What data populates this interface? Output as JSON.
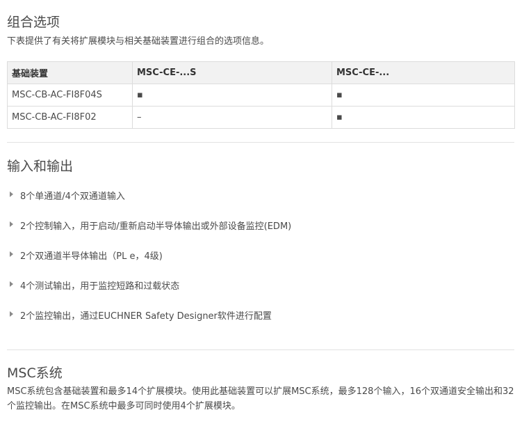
{
  "combo": {
    "title": "组合选项",
    "intro": "下表提供了有关将扩展模块与相关基础装置进行组合的选项信息。",
    "table": {
      "headers": [
        "基础装置",
        "MSC-CE-...S",
        "MSC-CE-..."
      ],
      "rows": [
        [
          "MSC-CB-AC-FI8F04S",
          "▪",
          "▪"
        ],
        [
          "MSC-CB-AC-FI8F02",
          "–",
          "▪"
        ]
      ]
    }
  },
  "io": {
    "title": "输入和输出",
    "items": [
      "8个单通道/4个双通道输入",
      "2个控制输入，用于启动/重新启动半导体输出或外部设备监控(EDM)",
      "2个双通道半导体输出（PL e，4级)",
      "4个测试输出，用于监控短路和过载状态",
      "2个监控输出，通过EUCHNER Safety Designer软件进行配置"
    ],
    "bullet_icon": "triangle-right-icon"
  },
  "msc": {
    "title": "MSC系统",
    "text": "MSC系统包含基础装置和最多14个扩展模块。使用此基础装置可以扩展MSC系统，最多128个输入，16个双通道安全输出和32个监控输出。在MSC系统中最多可同时使用4个扩展模块。"
  }
}
